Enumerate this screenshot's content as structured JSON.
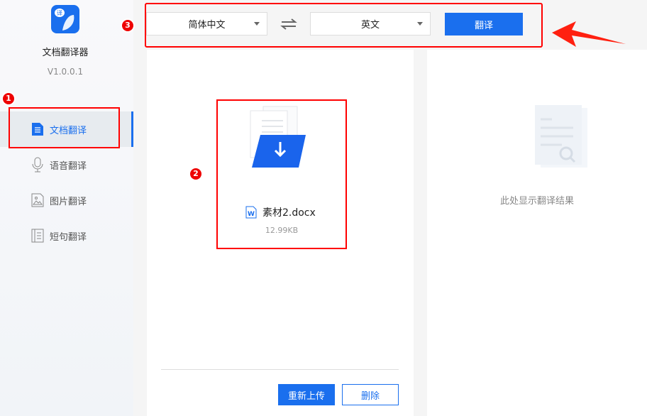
{
  "sidebar": {
    "app_name": "文档翻译器",
    "version": "V1.0.0.1",
    "logo_text": "译",
    "items": [
      {
        "label": "文档翻译",
        "icon": "document-icon",
        "active": true
      },
      {
        "label": "语音翻译",
        "icon": "microphone-icon"
      },
      {
        "label": "图片翻译",
        "icon": "image-icon"
      },
      {
        "label": "短句翻译",
        "icon": "text-icon"
      }
    ]
  },
  "toolbar": {
    "source_lang": "简体中文",
    "target_lang": "英文",
    "translate_label": "翻译"
  },
  "upload": {
    "file_name": "素材2.docx",
    "file_size": "12.99KB",
    "reupload_label": "重新上传",
    "delete_label": "删除"
  },
  "result": {
    "placeholder": "此处显示翻译结果"
  },
  "annotations": {
    "one": "1",
    "two": "2",
    "three": "3"
  },
  "colors": {
    "accent": "#1a6fee",
    "annotation": "#ff0000"
  }
}
